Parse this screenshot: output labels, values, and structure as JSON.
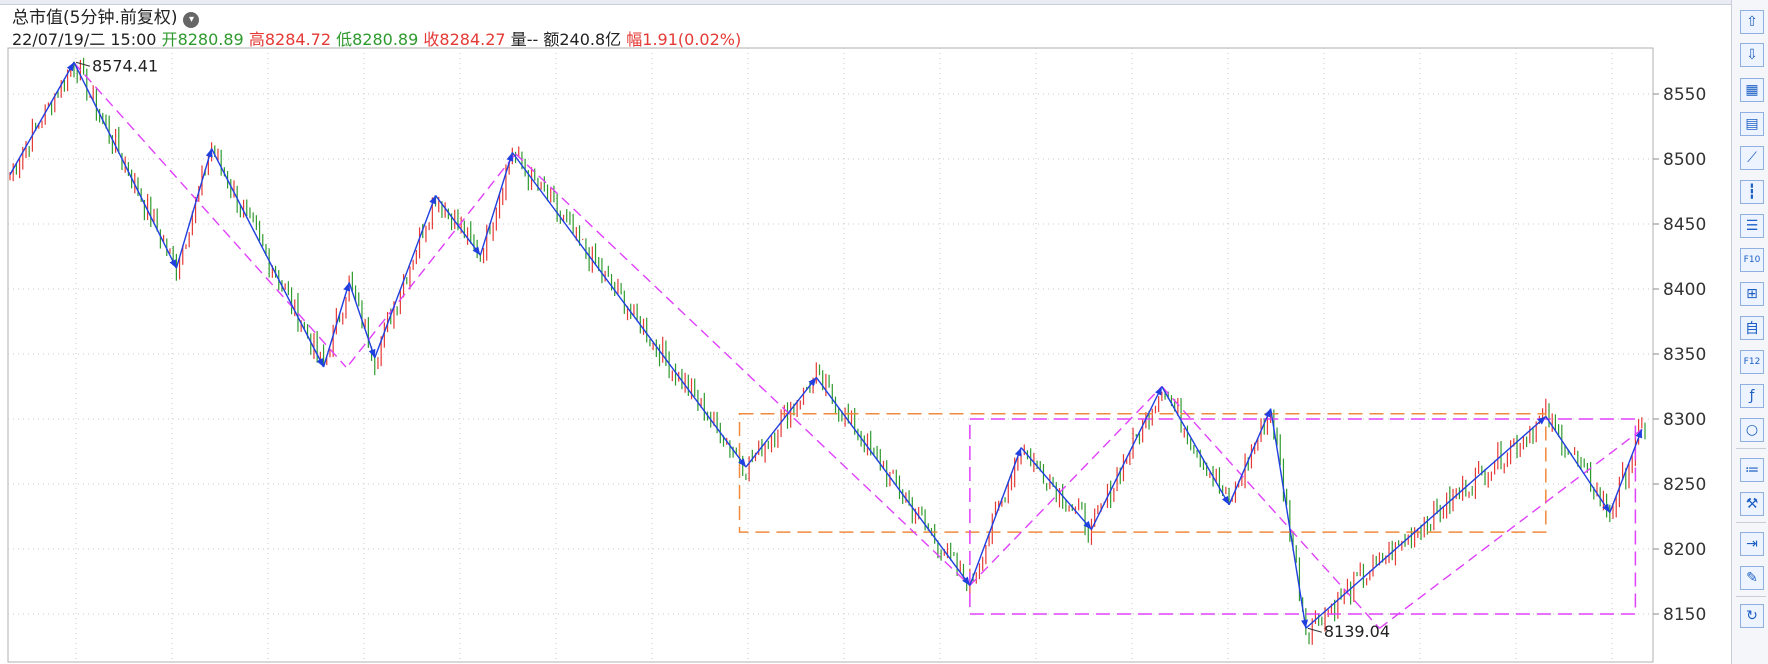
{
  "header": {
    "title": "总市值(5分钟.前复权)",
    "datetime": "22/07/19/二 15:00",
    "open_label": "开",
    "open": "8280.89",
    "high_label": "高",
    "high": "8284.72",
    "low_label": "低",
    "low": "8280.89",
    "close_label": "收",
    "close": "8284.27",
    "volume_label": "量",
    "volume": "--",
    "amount_label": "额",
    "amount": "240.8亿",
    "change_label": "幅",
    "change": "1.91(0.02%)"
  },
  "colors": {
    "up": "#e53935",
    "down": "#2e9a2e",
    "zigzag": "#1f3fe0",
    "trend_dashed": "#e040fb",
    "box_orange": "#f08a3c",
    "grid": "#c9c9c9"
  },
  "toolbar": {
    "icons": [
      "arrow-up-icon",
      "arrow-down-icon",
      "table-color-icon",
      "table-icon",
      "line-chart-icon",
      "candlestick-icon",
      "list-icon",
      "f10-icon",
      "tree-icon",
      "self-select-icon",
      "f12-icon",
      "formula-icon",
      "circle-icon",
      "indicator-list-icon",
      "tools-icon",
      "export-icon",
      "pencil-icon",
      "refresh-icon"
    ],
    "labels": [
      "⇧",
      "⇩",
      "▦",
      "▤",
      "⟋",
      "┇",
      "☰",
      "F10",
      "⊞",
      "自",
      "F12",
      "ƒ",
      "○",
      "≔",
      "⚒",
      "⇥",
      "✎",
      "↻"
    ]
  },
  "chart_data": {
    "type": "candlestick",
    "title": "总市值(5分钟.前复权)",
    "ylim": [
      8130,
      8580
    ],
    "y_ticks": [
      {
        "value": 8550,
        "label": "8550"
      },
      {
        "value": 8500,
        "label": "8500"
      },
      {
        "value": 8450,
        "label": "8450"
      },
      {
        "value": 8400,
        "label": "8400"
      },
      {
        "value": 8350,
        "label": "8350"
      },
      {
        "value": 8300,
        "label": "8300"
      },
      {
        "value": 8250,
        "label": "8250"
      },
      {
        "value": 8200,
        "label": "8200"
      },
      {
        "value": 8150,
        "label": "8150"
      }
    ],
    "grid": true,
    "annotations": [
      {
        "text": "8574.41",
        "bar": 20,
        "value": 8574.41
      },
      {
        "text": "8139.04",
        "bar": 405,
        "value": 8139.04
      }
    ],
    "zigzag": [
      {
        "bar": 0,
        "value": 8488
      },
      {
        "bar": 20,
        "value": 8574.41
      },
      {
        "bar": 52,
        "value": 8416
      },
      {
        "bar": 63,
        "value": 8508
      },
      {
        "bar": 98,
        "value": 8340
      },
      {
        "bar": 106,
        "value": 8405
      },
      {
        "bar": 114,
        "value": 8347
      },
      {
        "bar": 133,
        "value": 8472
      },
      {
        "bar": 147,
        "value": 8426
      },
      {
        "bar": 157,
        "value": 8505
      },
      {
        "bar": 230,
        "value": 8263
      },
      {
        "bar": 252,
        "value": 8332
      },
      {
        "bar": 300,
        "value": 8172
      },
      {
        "bar": 316,
        "value": 8278
      },
      {
        "bar": 338,
        "value": 8215
      },
      {
        "bar": 360,
        "value": 8325
      },
      {
        "bar": 381,
        "value": 8234
      },
      {
        "bar": 394,
        "value": 8308
      },
      {
        "bar": 405,
        "value": 8139.04
      },
      {
        "bar": 480,
        "value": 8302
      },
      {
        "bar": 500,
        "value": 8228
      },
      {
        "bar": 510,
        "value": 8292
      }
    ],
    "trend_lines": [
      {
        "from": {
          "bar": 20,
          "value": 8574
        },
        "to": {
          "bar": 105,
          "value": 8340
        }
      },
      {
        "from": {
          "bar": 106,
          "value": 8342
        },
        "to": {
          "bar": 158,
          "value": 8504
        }
      },
      {
        "from": {
          "bar": 158,
          "value": 8504
        },
        "to": {
          "bar": 300,
          "value": 8172
        }
      },
      {
        "from": {
          "bar": 300,
          "value": 8172
        },
        "to": {
          "bar": 360,
          "value": 8325
        }
      },
      {
        "from": {
          "bar": 360,
          "value": 8325
        },
        "to": {
          "bar": 428,
          "value": 8139
        }
      },
      {
        "from": {
          "bar": 428,
          "value": 8139
        },
        "to": {
          "bar": 510,
          "value": 8292
        }
      }
    ],
    "boxes": [
      {
        "color": "orange",
        "bar_from": 228,
        "bar_to": 480,
        "value_top": 8304,
        "value_bottom": 8213
      },
      {
        "color": "magenta",
        "bar_from": 300,
        "bar_to": 508,
        "value_top": 8300,
        "value_bottom": 8150
      }
    ],
    "series": [
      {
        "name": "ohlc",
        "generated_from_zigzag": true,
        "bar_count": 512
      }
    ]
  }
}
